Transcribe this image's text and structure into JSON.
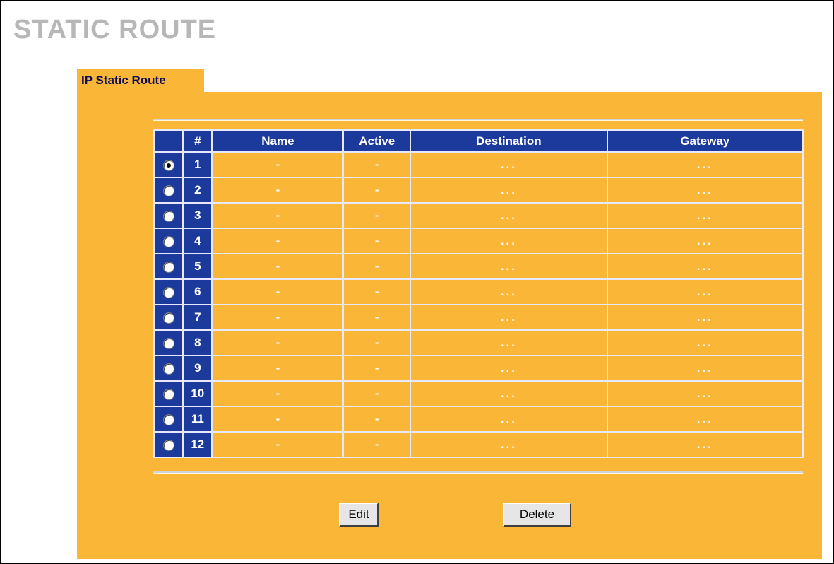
{
  "page_title": "STATIC ROUTE",
  "tab_label": "IP Static Route",
  "table": {
    "headers": {
      "sel": "",
      "num": "#",
      "name": "Name",
      "active": "Active",
      "destination": "Destination",
      "gateway": "Gateway"
    },
    "rows": [
      {
        "num": "1",
        "selected": true,
        "name": "-",
        "active": "-",
        "destination": "...",
        "gateway": "..."
      },
      {
        "num": "2",
        "selected": false,
        "name": "-",
        "active": "-",
        "destination": "...",
        "gateway": "..."
      },
      {
        "num": "3",
        "selected": false,
        "name": "-",
        "active": "-",
        "destination": "...",
        "gateway": "..."
      },
      {
        "num": "4",
        "selected": false,
        "name": "-",
        "active": "-",
        "destination": "...",
        "gateway": "..."
      },
      {
        "num": "5",
        "selected": false,
        "name": "-",
        "active": "-",
        "destination": "...",
        "gateway": "..."
      },
      {
        "num": "6",
        "selected": false,
        "name": "-",
        "active": "-",
        "destination": "...",
        "gateway": "..."
      },
      {
        "num": "7",
        "selected": false,
        "name": "-",
        "active": "-",
        "destination": "...",
        "gateway": "..."
      },
      {
        "num": "8",
        "selected": false,
        "name": "-",
        "active": "-",
        "destination": "...",
        "gateway": "..."
      },
      {
        "num": "9",
        "selected": false,
        "name": "-",
        "active": "-",
        "destination": "...",
        "gateway": "..."
      },
      {
        "num": "10",
        "selected": false,
        "name": "-",
        "active": "-",
        "destination": "...",
        "gateway": "..."
      },
      {
        "num": "11",
        "selected": false,
        "name": "-",
        "active": "-",
        "destination": "...",
        "gateway": "..."
      },
      {
        "num": "12",
        "selected": false,
        "name": "-",
        "active": "-",
        "destination": "...",
        "gateway": "..."
      }
    ]
  },
  "buttons": {
    "edit": "Edit",
    "delete": "Delete"
  },
  "colors": {
    "panel": "#f9b637",
    "header": "#1c3a9c",
    "title": "#b7b7b7",
    "tab_text": "#0b0b55"
  }
}
